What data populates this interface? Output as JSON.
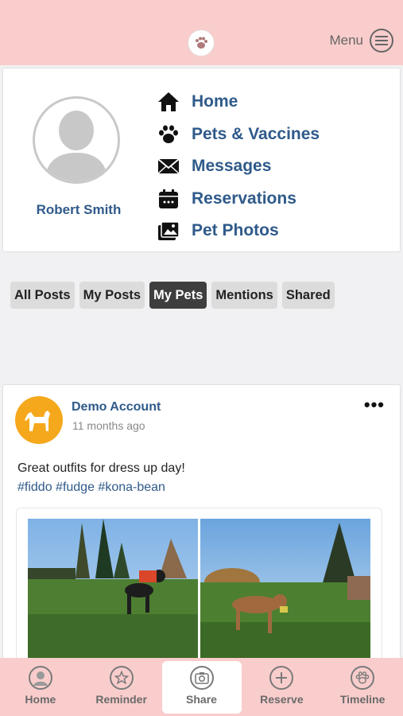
{
  "header": {
    "menu_label": "Menu",
    "logo_icon": "paw-logo-icon"
  },
  "profile": {
    "name": "Robert Smith"
  },
  "nav": {
    "items": [
      {
        "label": "Home",
        "icon": "home-icon"
      },
      {
        "label": "Pets & Vaccines",
        "icon": "paw-icon"
      },
      {
        "label": "Messages",
        "icon": "envelope-icon"
      },
      {
        "label": "Reservations",
        "icon": "calendar-icon"
      },
      {
        "label": "Pet Photos",
        "icon": "photos-icon"
      }
    ]
  },
  "tabs": {
    "items": [
      {
        "label": "All Posts"
      },
      {
        "label": "My Posts"
      },
      {
        "label": "My Pets"
      },
      {
        "label": "Mentions"
      },
      {
        "label": "Shared"
      }
    ],
    "active": "My Pets"
  },
  "post": {
    "author": "Demo Account",
    "time": "11 months ago",
    "more": "•••",
    "text": "Great outfits for dress up day!",
    "tags": "#fiddo #fudge #kona-bean"
  },
  "bottom_nav": {
    "items": [
      {
        "label": "Home",
        "icon": "user-icon"
      },
      {
        "label": "Reminder",
        "icon": "star-icon"
      },
      {
        "label": "Share",
        "icon": "camera-icon"
      },
      {
        "label": "Reserve",
        "icon": "plus-icon"
      },
      {
        "label": "Timeline",
        "icon": "paw-icon"
      }
    ],
    "active": "Share"
  },
  "colors": {
    "header_bg": "#f9cdcc",
    "link_blue": "#2f5a8a",
    "avatar_orange": "#f5a81c"
  }
}
